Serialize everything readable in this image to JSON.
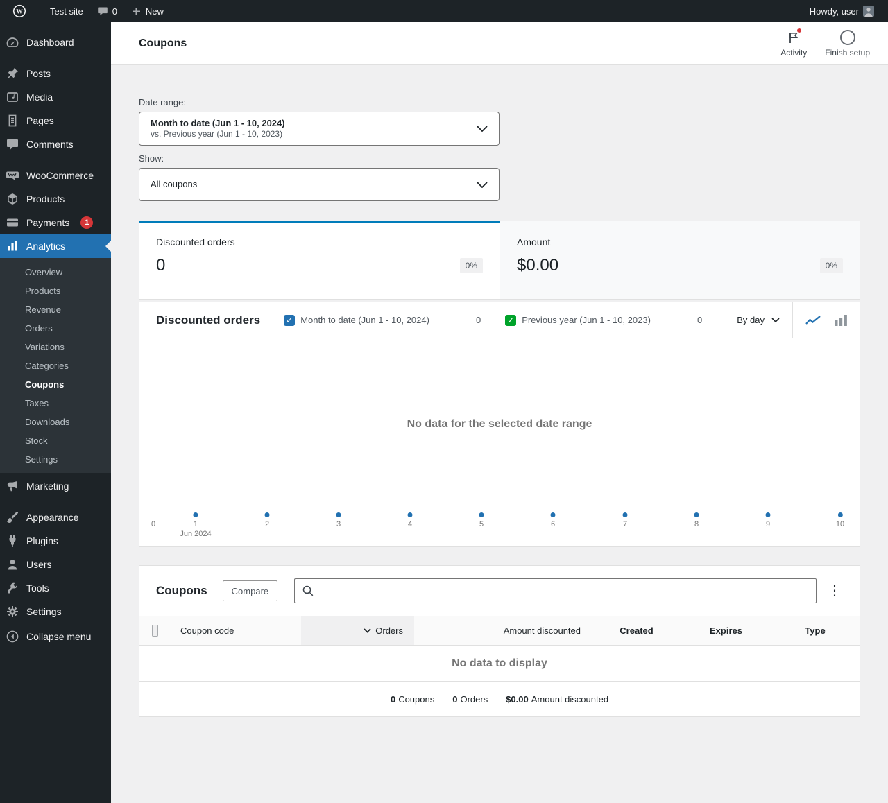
{
  "colors": {
    "sidebar_bg": "#1d2327",
    "content_bg": "#f0f0f1",
    "accent_blue": "#2271b1",
    "series_previous_green": "#00a32a",
    "notification_red": "#d63638",
    "selected_card_bar": "#007cba"
  },
  "icons": {
    "checkmark_glyph": "✓",
    "table_menu_glyph": "⋮"
  },
  "admin_bar": {
    "site_name": "Test site",
    "comments_count": "0",
    "new_label": "New",
    "howdy_text": "Howdy, user"
  },
  "sidebar": {
    "items": [
      {
        "label": "Dashboard"
      },
      {
        "label": "Posts"
      },
      {
        "label": "Media"
      },
      {
        "label": "Pages"
      },
      {
        "label": "Comments"
      },
      {
        "label": "WooCommerce"
      },
      {
        "label": "Products"
      },
      {
        "label": "Payments",
        "badge": "1"
      },
      {
        "label": "Analytics"
      },
      {
        "label": "Marketing"
      },
      {
        "label": "Appearance"
      },
      {
        "label": "Plugins"
      },
      {
        "label": "Users"
      },
      {
        "label": "Tools"
      },
      {
        "label": "Settings"
      },
      {
        "label": "Collapse menu"
      }
    ],
    "analytics_submenu": [
      {
        "label": "Overview"
      },
      {
        "label": "Products"
      },
      {
        "label": "Revenue"
      },
      {
        "label": "Orders"
      },
      {
        "label": "Variations"
      },
      {
        "label": "Categories"
      },
      {
        "label": "Coupons"
      },
      {
        "label": "Taxes"
      },
      {
        "label": "Downloads"
      },
      {
        "label": "Stock"
      },
      {
        "label": "Settings"
      }
    ]
  },
  "header": {
    "title": "Coupons",
    "activity_label": "Activity",
    "finish_setup_label": "Finish setup"
  },
  "filters": {
    "date_range_label": "Date range:",
    "date_range_value": "Month to date (Jun 1 - 10, 2024)",
    "date_range_compare": "vs. Previous year (Jun 1 - 10, 2023)",
    "show_label": "Show:",
    "show_value": "All coupons"
  },
  "summary_cards": [
    {
      "label": "Discounted orders",
      "value": "0",
      "delta": "0%"
    },
    {
      "label": "Amount",
      "value": "$0.00",
      "delta": "0%"
    }
  ],
  "chart": {
    "title": "Discounted orders",
    "legend": [
      {
        "label": "Month to date (Jun 1 - 10, 2024)",
        "value": "0"
      },
      {
        "label": "Previous year (Jun 1 - 10, 2023)",
        "value": "0"
      }
    ],
    "interval": "By day",
    "empty_message": "No data for the selected date range",
    "y_axis_zero": "0",
    "x_ticks": [
      "1",
      "2",
      "3",
      "4",
      "5",
      "6",
      "7",
      "8",
      "9",
      "10"
    ],
    "x_month_label": "Jun 2024"
  },
  "table": {
    "title": "Coupons",
    "compare_label": "Compare",
    "columns": [
      "Coupon code",
      "Orders",
      "Amount discounted",
      "Created",
      "Expires",
      "Type"
    ],
    "sorted_column": "Orders",
    "empty_message": "No data to display",
    "totals": [
      {
        "value": "0",
        "label": "Coupons"
      },
      {
        "value": "0",
        "label": "Orders"
      },
      {
        "value": "$0.00",
        "label": "Amount discounted"
      }
    ]
  }
}
